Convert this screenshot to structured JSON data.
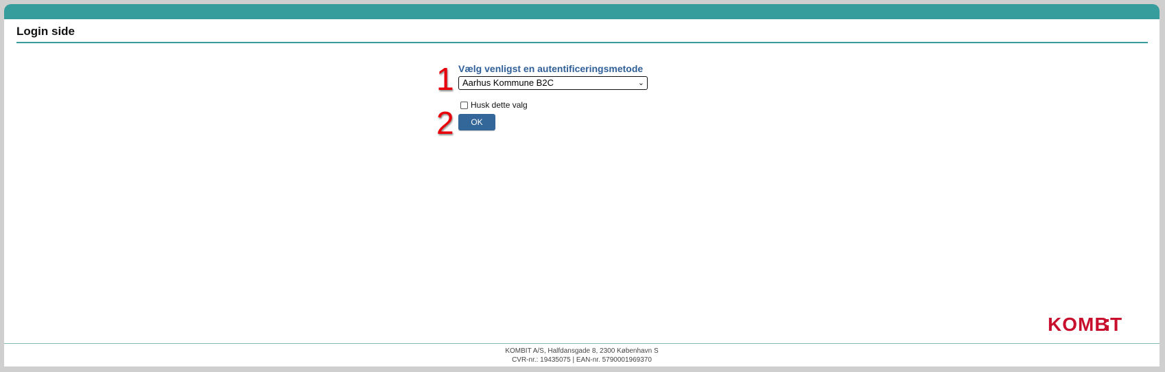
{
  "header": {
    "title": "Login side"
  },
  "form": {
    "markers": [
      "1",
      "2"
    ],
    "method_label": "Vælg venligst en autentificeringsmetode",
    "selected_method": "Aarhus Kommune B2C",
    "remember_label": "Husk dette valg",
    "remember_checked": false,
    "ok_label": "OK"
  },
  "footer": {
    "logo_text": "KOMBIT",
    "address": "KOMBIT A/S, Halfdansgade 8, 2300 København S",
    "ids": "CVR-nr.: 19435075 | EAN-nr. 5790001969370"
  },
  "colors": {
    "accent": "#369c9c",
    "button": "#336699",
    "label": "#2f5f99",
    "marker": "#e8000b",
    "logo": "#c8102e"
  }
}
